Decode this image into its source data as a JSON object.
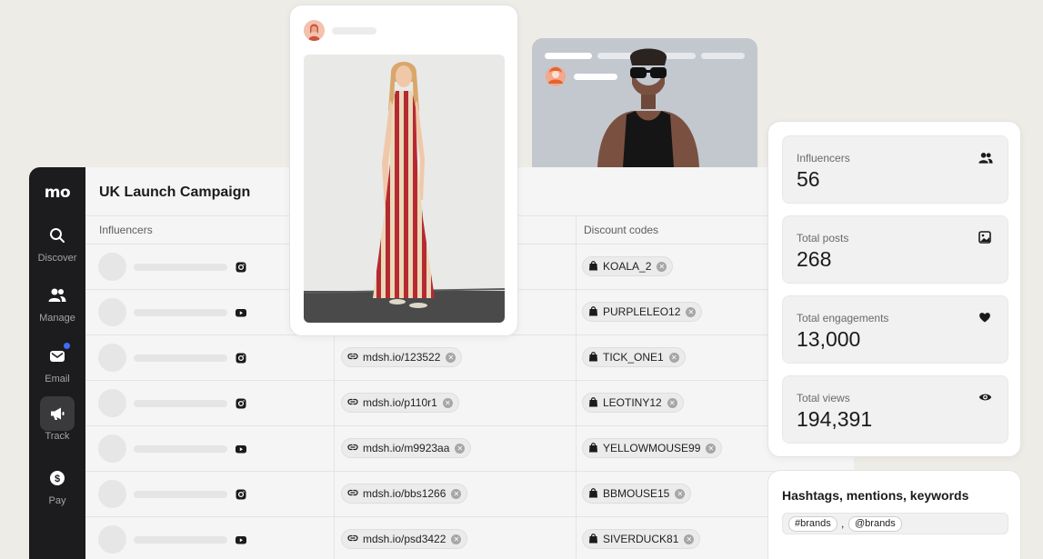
{
  "sidebar": {
    "logo": "mo",
    "items": [
      {
        "label": "Discover",
        "icon": "search-icon"
      },
      {
        "label": "Manage",
        "icon": "users-icon"
      },
      {
        "label": "Email",
        "icon": "mail-icon"
      },
      {
        "label": "Track",
        "icon": "megaphone-icon"
      },
      {
        "label": "Pay",
        "icon": "dollar-icon"
      }
    ]
  },
  "main": {
    "title": "UK Launch Campaign",
    "columns": {
      "influencers": "Influencers",
      "discount_codes": "Discount codes"
    },
    "rows": [
      {
        "platform": "instagram",
        "link": "",
        "code": "KOALA_2"
      },
      {
        "platform": "youtube",
        "link": "",
        "code": "PURPLELEO12"
      },
      {
        "platform": "instagram",
        "link": "mdsh.io/123522",
        "code": "TICK_ONE1"
      },
      {
        "platform": "instagram",
        "link": "mdsh.io/p110r1",
        "code": "LEOTINY12"
      },
      {
        "platform": "youtube",
        "link": "mdsh.io/m9923aa",
        "code": "YELLOWMOUSE99"
      },
      {
        "platform": "instagram",
        "link": "mdsh.io/bbs1266",
        "code": "BBMOUSE15"
      },
      {
        "platform": "youtube",
        "link": "mdsh.io/psd3422",
        "code": "SIVERDUCK81"
      }
    ]
  },
  "stats": [
    {
      "label": "Influencers",
      "value": "56",
      "icon": "users-icon"
    },
    {
      "label": "Total posts",
      "value": "268",
      "icon": "image-icon"
    },
    {
      "label": "Total engagements",
      "value": "13,000",
      "icon": "heart-icon"
    },
    {
      "label": "Total views",
      "value": "194,391",
      "icon": "eye-icon"
    }
  ],
  "hashtags": {
    "title": "Hashtags, mentions, keywords",
    "tags": [
      "#brands",
      "@brands"
    ],
    "separator": ","
  },
  "colors": {
    "sidebar": "#1c1c1e",
    "accent_dot": "#3d6bff",
    "background": "#eeece6"
  }
}
